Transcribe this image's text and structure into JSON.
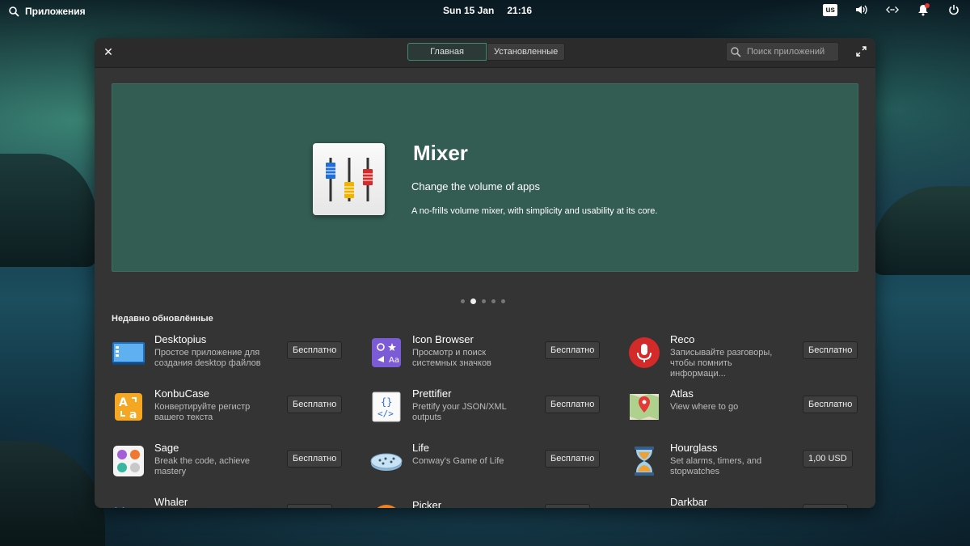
{
  "topbar": {
    "apps_label": "Приложения",
    "date": "Sun 15 Jan",
    "time": "21:16",
    "keyboard_layout": "us"
  },
  "headerbar": {
    "tabs": [
      {
        "label": "Главная",
        "active": true
      },
      {
        "label": "Установленные",
        "active": false
      }
    ],
    "search_placeholder": "Поиск приложений"
  },
  "banner": {
    "title": "Mixer",
    "summary": "Change the volume of apps",
    "description": "A no-frills volume mixer, with simplicity and usability at its core.",
    "carousel_count": 5,
    "carousel_active": 2
  },
  "section": {
    "title": "Недавно обновлённые"
  },
  "apps": [
    {
      "name": "Desktopius",
      "desc": "Простое приложение для создания desktop файлов",
      "price": "Бесплатно",
      "icon": "desktop-file-icon"
    },
    {
      "name": "Icon Browser",
      "desc": "Просмотр и поиск системных значков",
      "price": "Бесплатно",
      "icon": "icon-browser-icon"
    },
    {
      "name": "Reco",
      "desc": "Записывайте разговоры, чтобы помнить информаци...",
      "price": "Бесплатно",
      "icon": "microphone-icon"
    },
    {
      "name": "KonbuCase",
      "desc": "Конвертируйте регистр вашего текста",
      "price": "Бесплатно",
      "icon": "text-case-icon"
    },
    {
      "name": "Prettifier",
      "desc": "Prettify your JSON/XML outputs",
      "price": "Бесплатно",
      "icon": "code-document-icon"
    },
    {
      "name": "Atlas",
      "desc": "View where to go",
      "price": "Бесплатно",
      "icon": "map-pin-icon"
    },
    {
      "name": "Sage",
      "desc": "Break the code, achieve mastery",
      "price": "Бесплатно",
      "icon": "colored-dots-icon"
    },
    {
      "name": "Life",
      "desc": "Conway's Game of Life",
      "price": "Бесплатно",
      "icon": "petri-dish-icon"
    },
    {
      "name": "Hourglass",
      "desc": "Set alarms, timers, and stopwatches",
      "price": "1,00 USD",
      "icon": "hourglass-icon"
    },
    {
      "name": "Whaler",
      "desc": "",
      "price": "",
      "icon": "whale-icon"
    },
    {
      "name": "Picker",
      "desc": "",
      "price": "",
      "icon": "color-picker-icon"
    },
    {
      "name": "Darkbar",
      "desc": "",
      "price": "",
      "icon": "darkbar-icon"
    }
  ]
}
